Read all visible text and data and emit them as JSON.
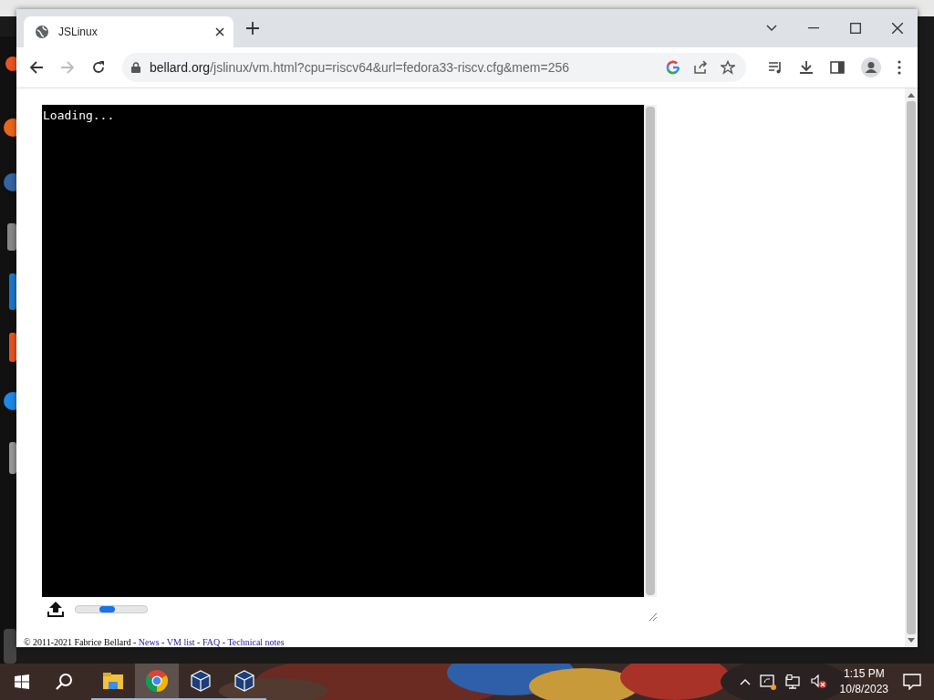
{
  "browser": {
    "tabs": [
      {
        "title": "JSLinux",
        "selected": true
      }
    ],
    "url_host": "bellard.org",
    "url_path": "/jslinux/vm.html?cpu=riscv64&url=fedora33-riscv.cfg&mem=256"
  },
  "page": {
    "terminal_text": "Loading...",
    "footer": {
      "copyright": "© 2011-2021 Fabrice Bellard",
      "separator": " - ",
      "links": [
        "News",
        "VM list",
        "FAQ",
        "Technical notes"
      ]
    }
  },
  "taskbar": {
    "apps": [
      {
        "kind": "folder",
        "selected": false
      },
      {
        "kind": "chrome",
        "selected": true
      },
      {
        "kind": "cube",
        "selected": false
      },
      {
        "kind": "cube",
        "selected": false
      }
    ],
    "time": "1:15 PM",
    "date": "10/8/2023"
  }
}
